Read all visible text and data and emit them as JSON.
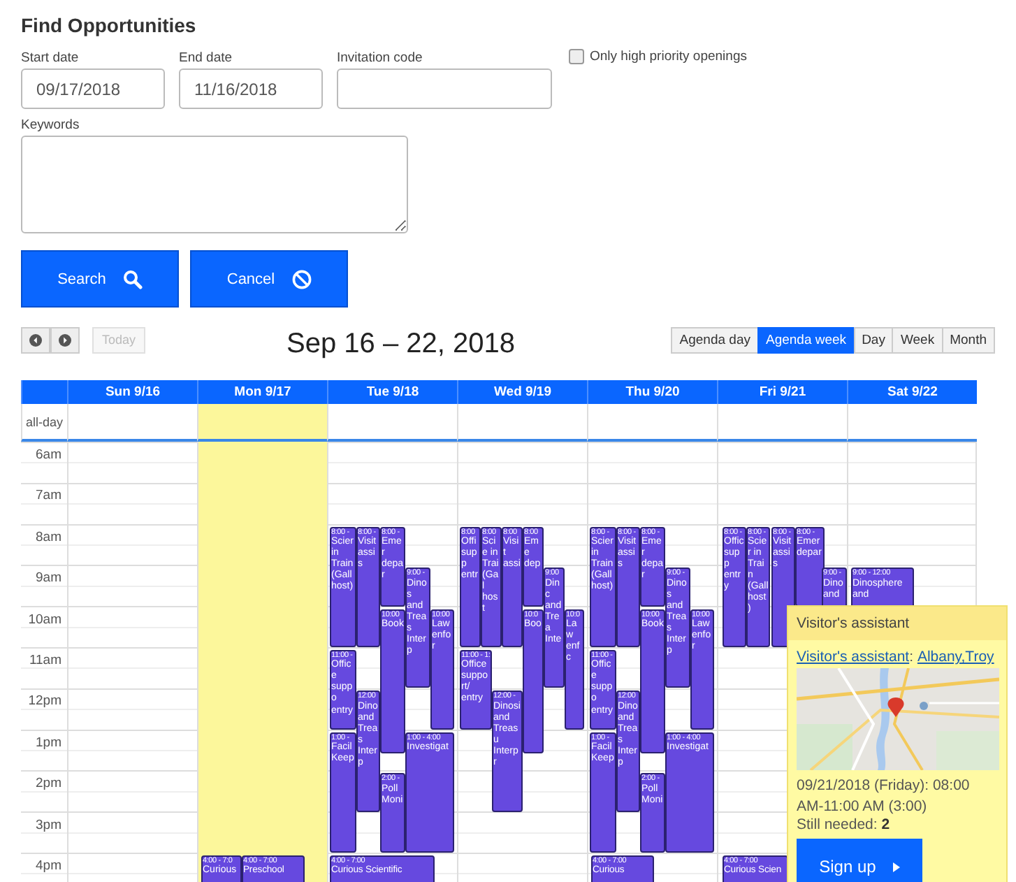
{
  "title": "Find Opportunities",
  "fields": [
    {
      "label": "Start date",
      "value": "09/17/2018"
    },
    {
      "label": "End date",
      "value": "11/16/2018"
    },
    {
      "label": "Invitation code"
    }
  ],
  "priority": {
    "label": "Only high priority openings",
    "checked": false
  },
  "keywords": {
    "label": "Keywords"
  },
  "buttons": [
    {
      "label": "Search",
      "kind": "search"
    },
    {
      "label": "Cancel",
      "kind": "cancel"
    }
  ],
  "toolbar": {
    "today": "Today",
    "range": "Sep 16 – 22, 2018",
    "views": [
      {
        "label": "Agenda day",
        "selected": false
      },
      {
        "label": "Agenda week",
        "selected": true
      },
      {
        "label": "Day",
        "selected": false
      },
      {
        "label": "Week",
        "selected": false
      },
      {
        "label": "Month",
        "selected": false
      }
    ]
  },
  "calendar": {
    "all_day": "all-day",
    "hours": [
      "6am",
      "7am",
      "8am",
      "9am",
      "10am",
      "11am",
      "12pm",
      "1pm",
      "2pm",
      "3pm",
      "4pm"
    ],
    "days": [
      {
        "label": "Sun 9/16",
        "today": false
      },
      {
        "label": "Mon 9/17",
        "today": true,
        "events": [
          {
            "time": "4:00 - 7:0",
            "title": "Curious"
          },
          {
            "time": "4:00 - 7:00",
            "title": "Preschool"
          }
        ]
      },
      {
        "label": "Tue 9/18",
        "today": false,
        "events": [
          {
            "time": "8:00 -",
            "title": "Scier in Train (Gall host)"
          },
          {
            "time": "8:00 -",
            "title": "Visit assis"
          },
          {
            "time": "8:00 -",
            "title": "Emer depar"
          },
          {
            "time": "9:00 -",
            "title": "Dinos and Treas Interp"
          },
          {
            "time": "10:00",
            "title": "Book"
          },
          {
            "time": "10:00",
            "title": "Law enfor"
          },
          {
            "time": "11:00 -",
            "title": "Office suppo entry"
          },
          {
            "time": "1:00 -",
            "title": "Facil Keep"
          },
          {
            "time": "12:00",
            "title": "Dino and Treas Interp"
          },
          {
            "time": "1:00 - 4:00",
            "title": "Investigat"
          },
          {
            "time": "2:00 -",
            "title": "Poll Moni"
          },
          {
            "time": "4:00 - 7:00",
            "title": "Curious Scientific"
          }
        ]
      },
      {
        "label": "Wed 9/19",
        "today": false,
        "events": [
          {
            "time": "8:00",
            "title": "Offi supp entr"
          },
          {
            "time": "8:00",
            "title": "Scie in Trai (Gal host"
          },
          {
            "time": "8:00",
            "title": "Visit assi"
          },
          {
            "time": "8:00",
            "title": "Eme dep"
          },
          {
            "time": "10:0",
            "title": "Boo"
          },
          {
            "time": "9:00",
            "title": "Dinc and Trea Inte"
          },
          {
            "time": "10:0",
            "title": "Law enfc"
          },
          {
            "time": "11:00 - 1:",
            "title": "Office support/ entry"
          },
          {
            "time": "12:00 -",
            "title": "Dinosi and Treasu Interpr"
          }
        ]
      },
      {
        "label": "Thu 9/20",
        "today": false,
        "events": [
          {
            "time": "8:00 -",
            "title": "Scier in Train (Gall host)"
          },
          {
            "time": "8:00 -",
            "title": "Visit assis"
          },
          {
            "time": "8:00 -",
            "title": "Emer depar"
          },
          {
            "time": "9:00 -",
            "title": "Dinos and Treas Interp"
          },
          {
            "time": "10:00",
            "title": "Book"
          },
          {
            "time": "10:00",
            "title": "Law enfor"
          },
          {
            "time": "11:00 -",
            "title": "Office suppo entry"
          },
          {
            "time": "1:00 -",
            "title": "Facil Keep"
          },
          {
            "time": "12:00",
            "title": "Dino and Treas Interp"
          },
          {
            "time": "1:00 - 4:00",
            "title": "Investigat"
          },
          {
            "time": "2:00 -",
            "title": "Poll Moni"
          },
          {
            "time": "4:00 - 7:00",
            "title": "Curious"
          }
        ]
      },
      {
        "label": "Fri 9/21",
        "today": false,
        "events": [
          {
            "time": "8:00 -",
            "title": "Offic supp entry"
          },
          {
            "time": "8:00 -",
            "title": "Scier in Train (Gall host)"
          },
          {
            "time": "8:00 -",
            "title": "Visit assis"
          },
          {
            "time": "8:00 -",
            "title": "Emer depar"
          },
          {
            "time": "9:00 -",
            "title": "Dino and"
          },
          {
            "time": "4:00 - 7:00",
            "title": "Curious Scien"
          }
        ]
      },
      {
        "label": "Sat 9/22",
        "today": false,
        "events": [
          {
            "time": "9:00 - 12:00",
            "title": "Dinosphere and"
          }
        ]
      }
    ]
  },
  "popup": {
    "title": "Visitor's assistant",
    "link": "Visitor's assistant",
    "separator": ":",
    "location": "Albany,Troy",
    "when": "09/21/2018 (Friday): 08:00 AM-11:00 AM (3:00)",
    "needed_label": "Still needed:",
    "needed": "2",
    "button": "Sign up"
  }
}
